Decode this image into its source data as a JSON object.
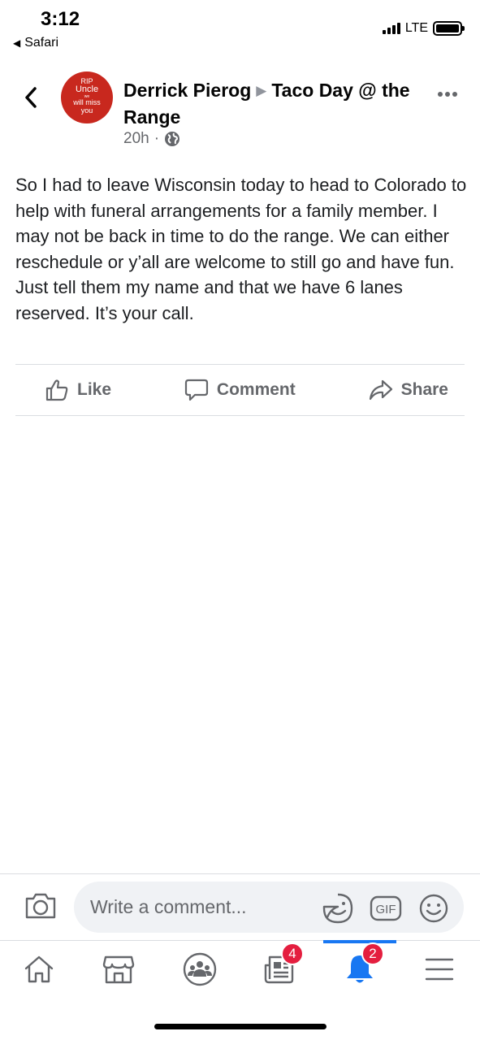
{
  "status_bar": {
    "time": "3:12",
    "back_app": "Safari",
    "network": "LTE",
    "back_icon": "triangle-left-icon",
    "signal_icon": "signal-bars-icon",
    "battery_icon": "battery-icon"
  },
  "post": {
    "author": "Derrick Pierog",
    "event": "Taco Day @ the Range",
    "time_ago": "20h",
    "separator": "·",
    "privacy_icon": "globe-icon",
    "avatar": {
      "line1": "RIP",
      "line2": "Uncle",
      "line3": "we",
      "line4": "will miss",
      "line5": "you"
    },
    "text": "So I had to leave Wisconsin today to head to Colorado to help with funeral arrangements for a family member. I may not be back in time to do the range. We can either reschedule or y’all are welcome to still go and have fun. Just tell them my name and that we have 6 lanes reserved. It’s your call."
  },
  "actions": {
    "like": "Like",
    "comment": "Comment",
    "share": "Share"
  },
  "comment_bar": {
    "placeholder": "Write a comment...",
    "gif_label": "GIF"
  },
  "bottom_nav": {
    "items": [
      {
        "icon": "home-icon",
        "badge": ""
      },
      {
        "icon": "marketplace-icon",
        "badge": ""
      },
      {
        "icon": "groups-icon",
        "badge": ""
      },
      {
        "icon": "news-feed-icon",
        "badge": "4"
      },
      {
        "icon": "notifications-bell-icon",
        "badge": "2"
      },
      {
        "icon": "menu-icon",
        "badge": ""
      }
    ]
  },
  "colors": {
    "accent": "#1877f2",
    "badge": "#e41e3f",
    "secondary_text": "#65676b",
    "avatar_bg": "#c8281e"
  }
}
